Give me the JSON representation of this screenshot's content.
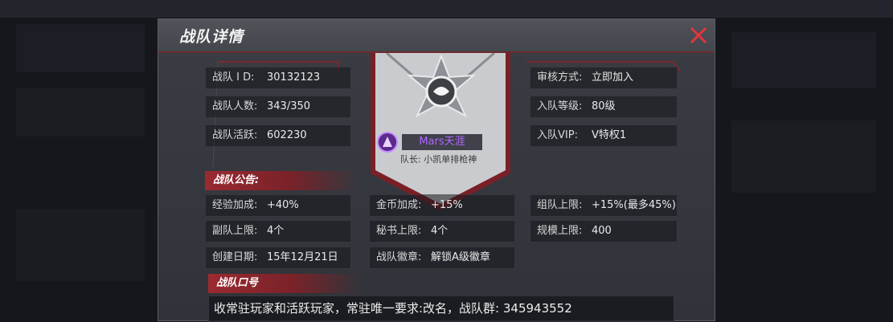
{
  "window": {
    "title": "战队详情",
    "close_icon": "close-x-icon",
    "accent": "#c8323a"
  },
  "team": {
    "id_label": "战队 I D:",
    "id_value": "30132123",
    "members_label": "战队人数:",
    "members_value": "343/350",
    "activity_label": "战队活跃:",
    "activity_value": "602230",
    "review_label": "审核方式:",
    "review_value": "立即加入",
    "level_label": "入队等级:",
    "level_value": "80级",
    "vip_label": "入队VIP:",
    "vip_value": "V特权1"
  },
  "leader": {
    "name": "Mars天涯",
    "caption": "队长: 小凯单排枪神",
    "badge_icon": "star-medal-icon"
  },
  "announcement": {
    "section_title": "战队公告:",
    "rows": [
      [
        {
          "label": "经验加成:",
          "value": "+40%"
        },
        {
          "label": "金币加成:",
          "value": "+15%"
        },
        {
          "label": "组队上限:",
          "value": "+15%(最多45%)"
        }
      ],
      [
        {
          "label": "副队上限:",
          "value": "4个"
        },
        {
          "label": "秘书上限:",
          "value": "4个"
        },
        {
          "label": "规模上限:",
          "value": "400"
        }
      ],
      [
        {
          "label": "创建日期:",
          "value": "15年12月21日"
        },
        {
          "label": "战队徽章:",
          "value": "解锁A级徽章"
        }
      ]
    ]
  },
  "slogan": {
    "section_title": "战队口号",
    "text": "收常驻玩家和活跃玩家，常驻唯一要求:改名，战队群: 345943552"
  }
}
